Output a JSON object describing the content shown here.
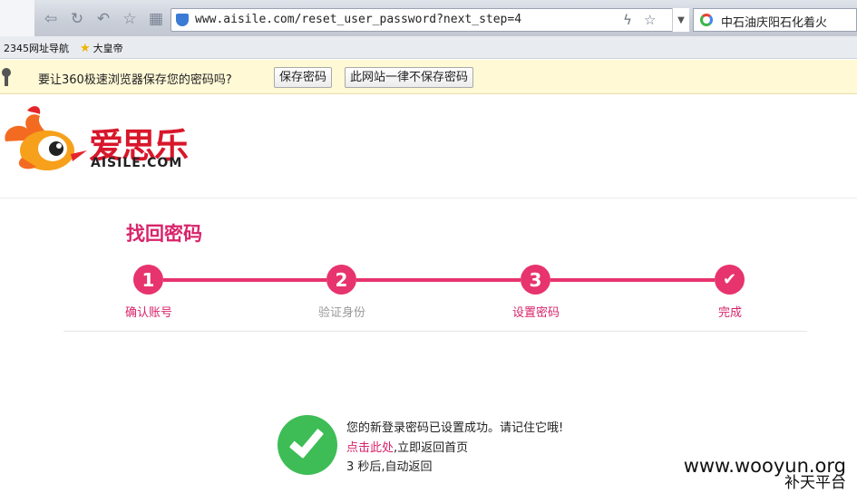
{
  "browser": {
    "url": "www.aisile.com/reset_user_password?next_step=4",
    "search_value": "中石油庆阳石化着火",
    "bookmarks": [
      "2345网址导航",
      "大皇帝"
    ]
  },
  "password_bar": {
    "message": "要让360极速浏览器保存您的密码吗?",
    "save_label": "保存密码",
    "never_label": "此网站一律不保存密码"
  },
  "logo": {
    "cn": "爱思乐",
    "en": "AISILE.COM"
  },
  "page": {
    "title": "找回密码",
    "steps": [
      {
        "num": "1",
        "label": "确认账号"
      },
      {
        "num": "2",
        "label": "验证身份"
      },
      {
        "num": "3",
        "label": "设置密码"
      },
      {
        "num": "✔",
        "label": "完成"
      }
    ],
    "colors": {
      "accent": "#e7336e",
      "success": "#3ebd56",
      "inactive_label": "#999999"
    }
  },
  "result": {
    "line1": "您的新登录密码已设置成功。请记住它哦!",
    "link": "点击此处",
    "line2_rest": ",立即返回首页",
    "line3": "3 秒后,自动返回"
  },
  "watermark": {
    "main": "www.wooyun.org",
    "sub": "补天平台"
  }
}
